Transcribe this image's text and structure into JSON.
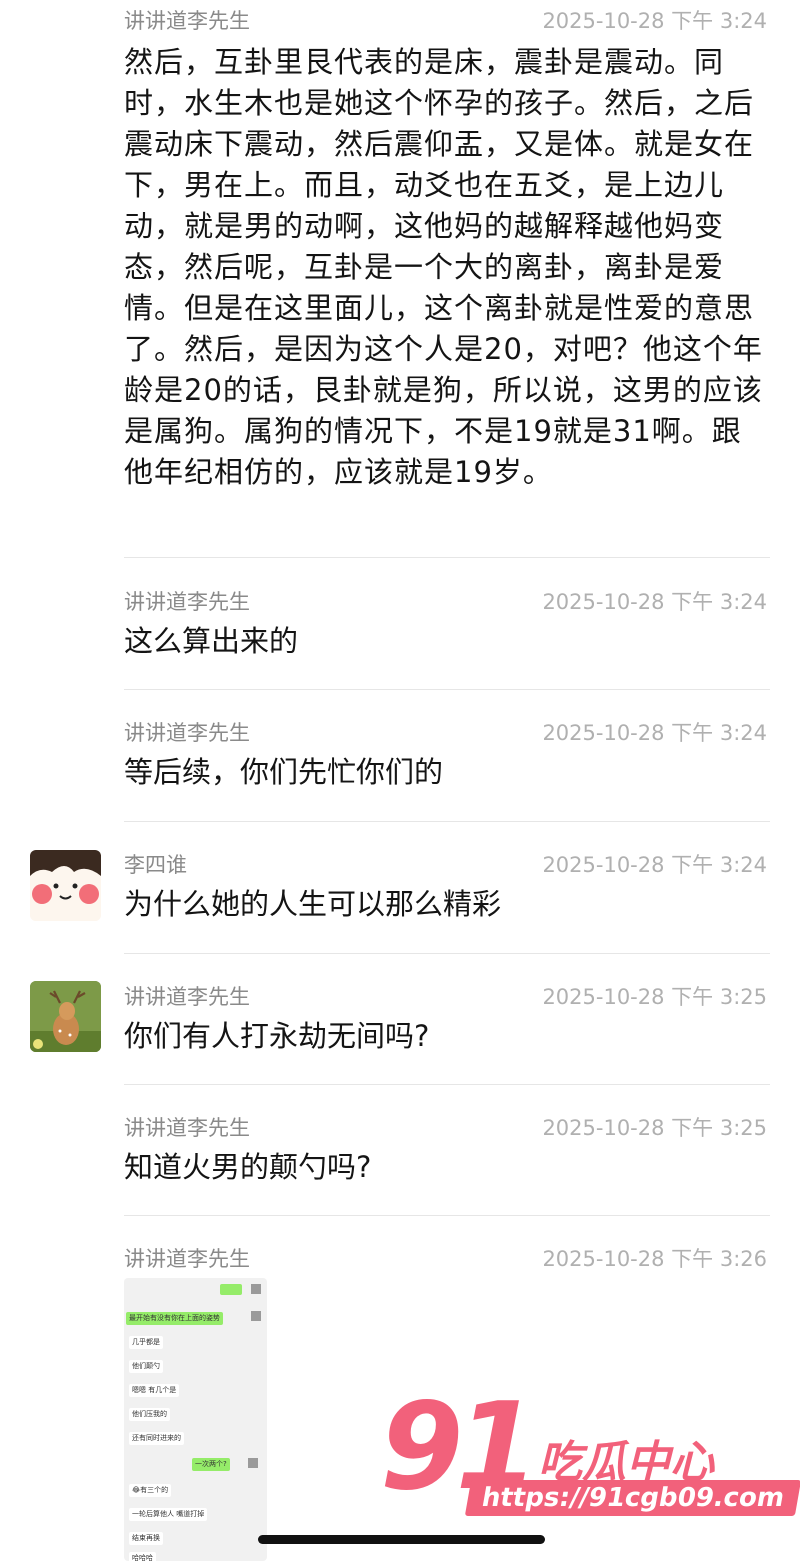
{
  "messages": [
    {
      "sender": "讲讲道李先生",
      "time": "2025-10-28 下午 3:24",
      "text": "然后，互卦里艮代表的是床，震卦是震动。同时，水生木也是她这个怀孕的孩子。然后，之后震动床下震动，然后震仰盂，又是体。就是女在下，男在上。而且，动爻也在五爻，是上边儿动，就是男的动啊，这他妈的越解释越他妈变态，然后呢，互卦是一个大的离卦，离卦是爱情。但是在这里面儿，这个离卦就是性爱的意思了。然后，是因为这个人是20，对吧？他这个年龄是20的话，艮卦就是狗，所以说，这男的应该是属狗。属狗的情况下，不是19就是31啊。跟他年纪相仿的，应该就是19岁。"
    },
    {
      "sender": "讲讲道李先生",
      "time": "2025-10-28 下午 3:24",
      "text": "这么算出来的"
    },
    {
      "sender": "讲讲道李先生",
      "time": "2025-10-28 下午 3:24",
      "text": "等后续，你们先忙你们的"
    },
    {
      "sender": "李四谁",
      "time": "2025-10-28 下午 3:24",
      "text": "为什么她的人生可以那么精彩"
    },
    {
      "sender": "讲讲道李先生",
      "time": "2025-10-28 下午 3:25",
      "text": "你们有人打永劫无间吗?"
    },
    {
      "sender": "讲讲道李先生",
      "time": "2025-10-28 下午 3:25",
      "text": "知道火男的颠勺吗?"
    },
    {
      "sender": "讲讲道李先生",
      "time": "2025-10-28 下午 3:26",
      "text": ""
    }
  ],
  "embedded_screenshot": {
    "lines": [
      "最开始有没有你在上面的姿势",
      "几乎都是",
      "他们颠勺",
      "嗯嗯 有几个是",
      "他们压我的",
      "还有同时进来的",
      "一次两个?",
      "😂有三个的",
      "一轮后算他人 嘴道打掉",
      "结束再换",
      "哈哈哈"
    ]
  },
  "watermark": {
    "number": "91",
    "brand": "吃瓜中心",
    "url": "https://91cgb09.com"
  },
  "colors": {
    "accent": "#f2617b",
    "wechat_green": "#95ec69"
  }
}
